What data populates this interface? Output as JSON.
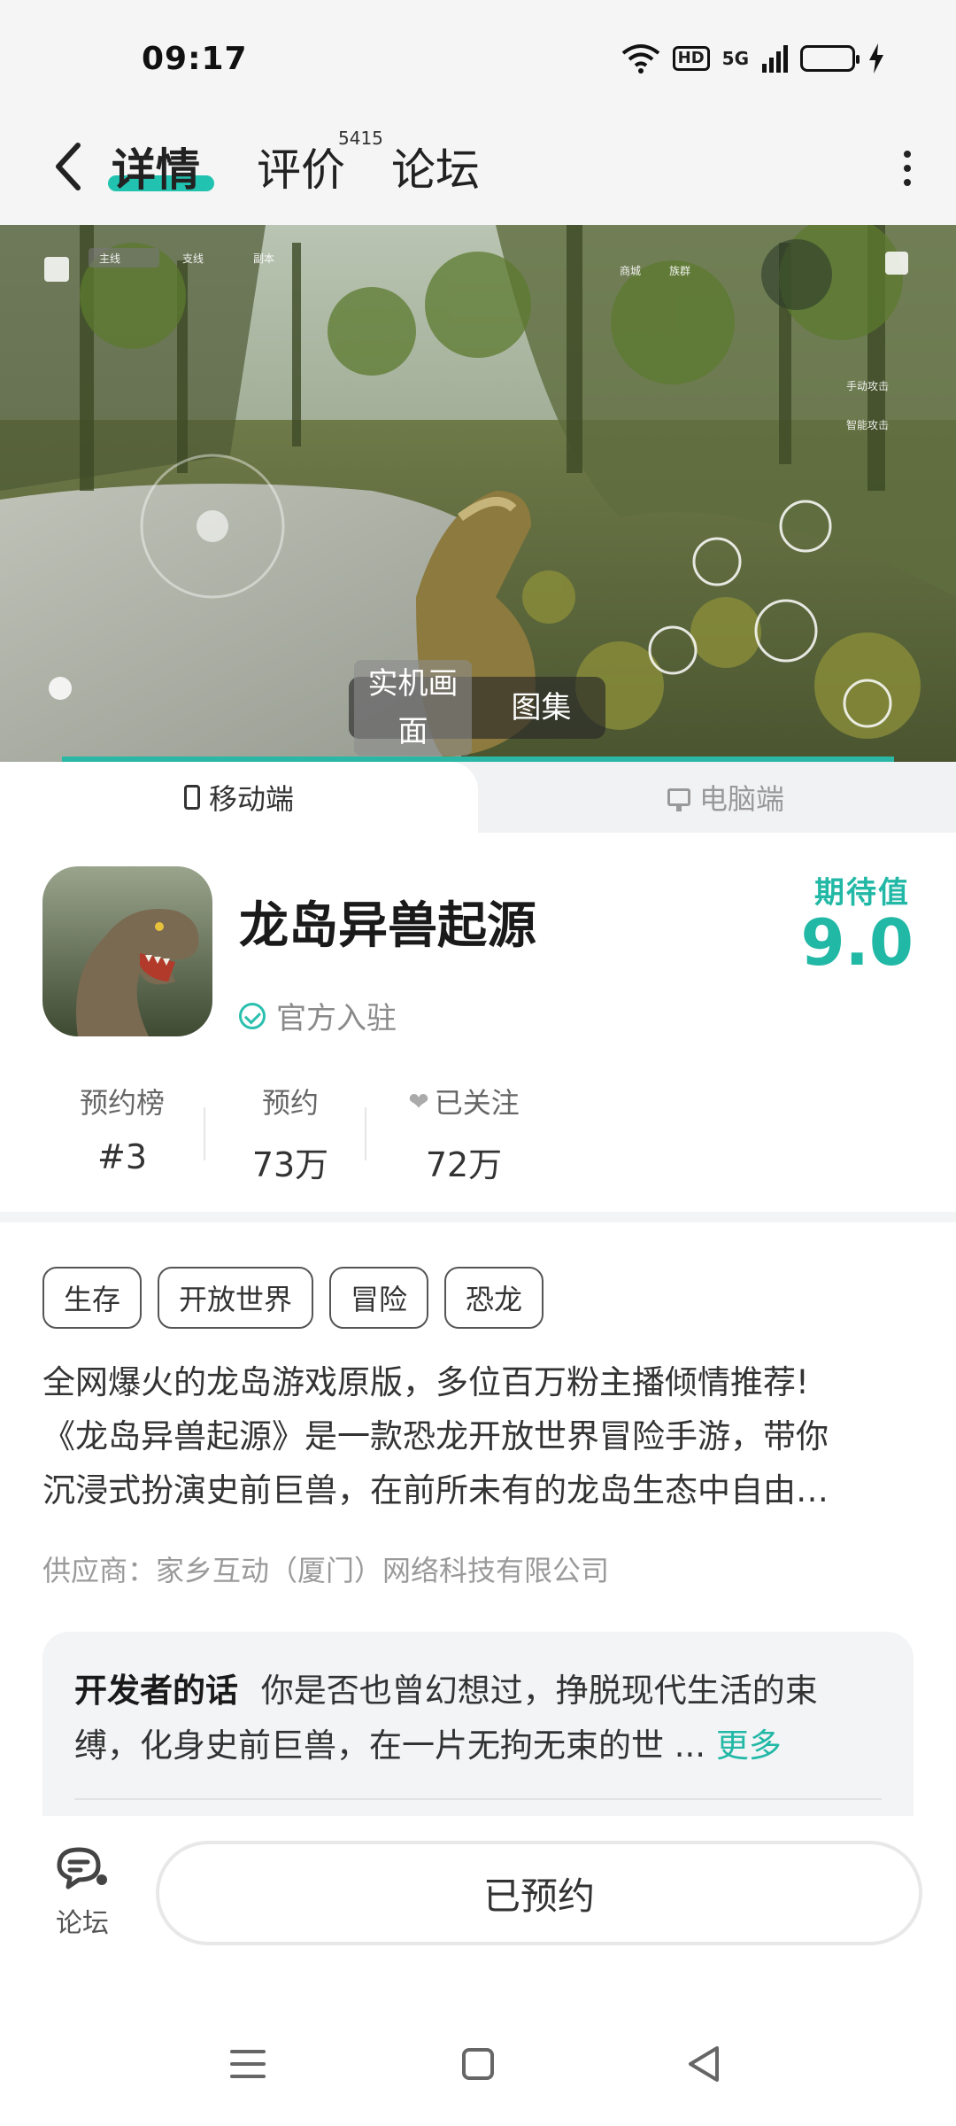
{
  "status_bar": {
    "time": "09:17",
    "hd": "HD",
    "network": "5G"
  },
  "header": {
    "tabs": [
      {
        "label": "详情",
        "active": true
      },
      {
        "label": "评价",
        "count": "5415"
      },
      {
        "label": "论坛"
      }
    ]
  },
  "media": {
    "switch": [
      {
        "label": "实机画面",
        "active": true
      },
      {
        "label": "图集"
      }
    ]
  },
  "platform_tabs": {
    "mobile": "移动端",
    "pc": "电脑端"
  },
  "game": {
    "title": "龙岛异兽起源",
    "official": "官方入驻",
    "expect_label": "期待值",
    "expect_score": "9.0",
    "stats": [
      {
        "label": "预约榜",
        "value": "#3"
      },
      {
        "label": "预约",
        "value": "73万"
      },
      {
        "label": "已关注",
        "value": "72万"
      }
    ],
    "tags": [
      "生存",
      "开放世界",
      "冒险",
      "恐龙"
    ],
    "description_lines": [
      "全网爆火的龙岛游戏原版，多位百万粉主播倾情推荐!",
      "《龙岛异兽起源》是一款恐龙开放世界冒险手游，带你",
      "沉浸式扮演史前巨兽，在前所未有的龙岛生态中自由…"
    ],
    "supplier": "供应商：家乡互动（厦门）网络科技有限公司"
  },
  "developer": {
    "title": "开发者的话",
    "text": "你是否也曾幻想过，挣脱现代生活的束缚，化身史前巨兽，在一片无拘无束的世 ...",
    "more": "更多"
  },
  "bottom": {
    "forum_label": "论坛",
    "reserve_label": "已预约"
  },
  "colors": {
    "accent": "#22b8a6",
    "text": "#1e1e1e",
    "muted": "#9a9a9a"
  }
}
